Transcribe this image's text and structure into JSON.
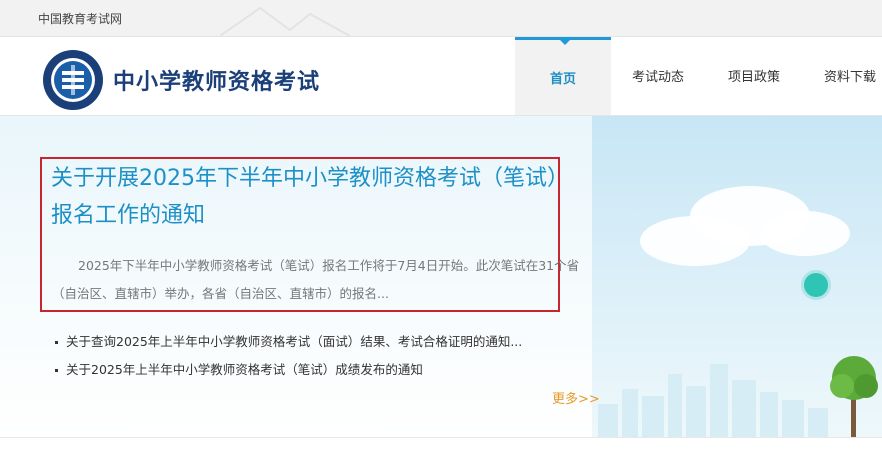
{
  "topbar": {
    "site_name": "中国教育考试网"
  },
  "header": {
    "brand": "中小学教师资格考试",
    "nav": [
      {
        "label": "首页",
        "active": true
      },
      {
        "label": "考试动态",
        "active": false
      },
      {
        "label": "项目政策",
        "active": false
      },
      {
        "label": "资料下载",
        "active": false
      }
    ]
  },
  "featured": {
    "title": "关于开展2025年下半年中小学教师资格考试（笔试）报名工作的通知",
    "summary": "2025年下半年中小学教师资格考试（笔试）报名工作将于7月4日开始。此次笔试在31个省（自治区、直辖市）举办，各省（自治区、直辖市）的报名..."
  },
  "news": [
    {
      "title": "关于查询2025年上半年中小学教师资格考试（面试）结果、考试合格证明的通知..."
    },
    {
      "title": "关于2025年上半年中小学教师资格考试（笔试）成绩发布的通知"
    }
  ],
  "more_link": "更多>>",
  "colors": {
    "accent": "#1f9ad6",
    "highlight_border": "#c8262f",
    "brand": "#1b3f78",
    "more": "#e59a2a"
  }
}
